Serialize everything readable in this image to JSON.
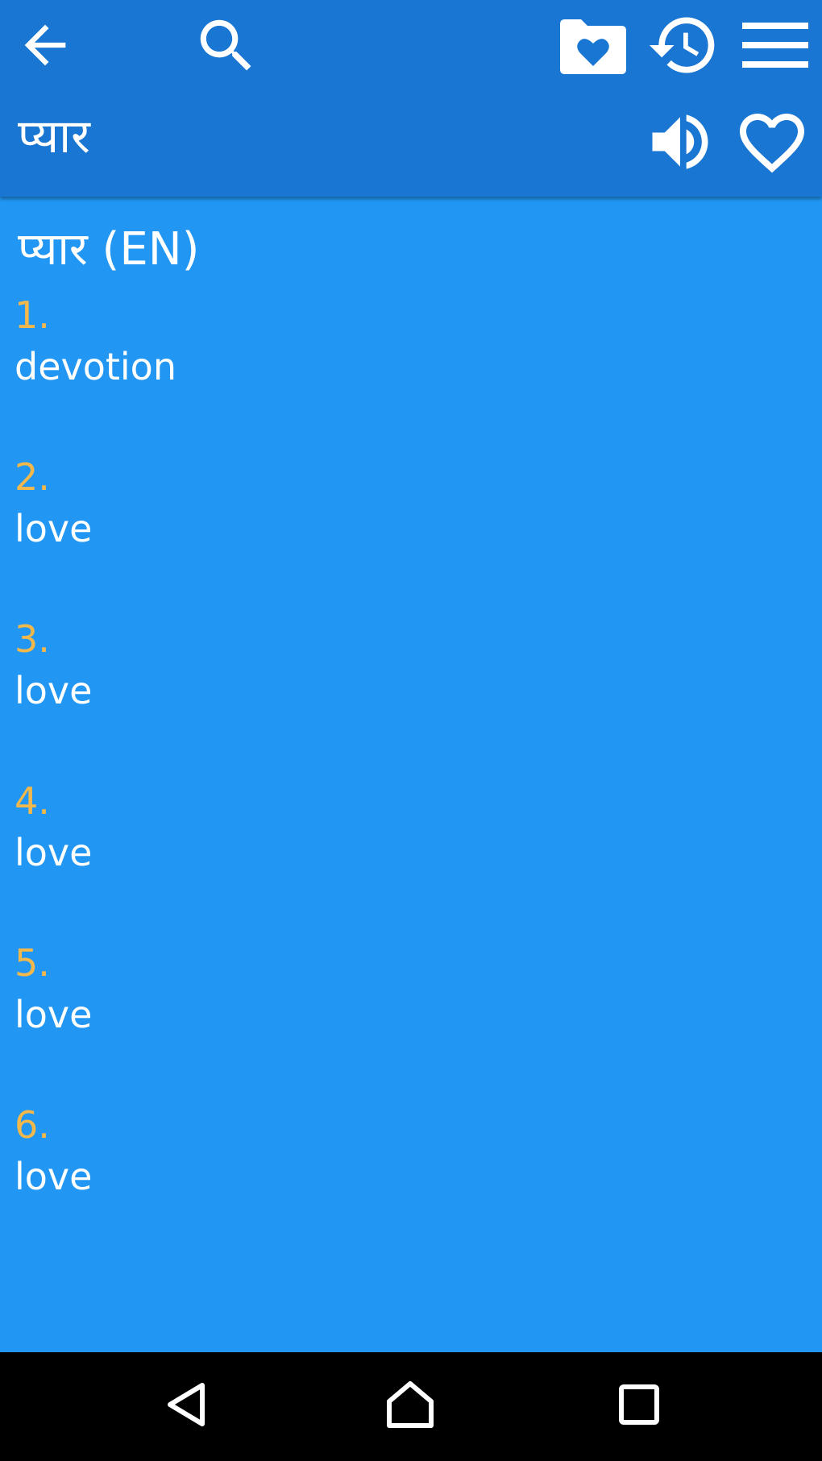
{
  "toolbar": {
    "icons": [
      "back-arrow-icon",
      "search-icon",
      "favorites-folder-icon",
      "history-icon",
      "menu-icon"
    ]
  },
  "word_bar": {
    "word": "प्यार",
    "icons": [
      "speaker-icon",
      "heart-outline-icon"
    ]
  },
  "entry": {
    "heading": "प्यार (EN)",
    "definitions": [
      {
        "number": "1.",
        "text": "devotion"
      },
      {
        "number": "2.",
        "text": "love"
      },
      {
        "number": "3.",
        "text": "love"
      },
      {
        "number": "4.",
        "text": "love"
      },
      {
        "number": "5.",
        "text": "love"
      },
      {
        "number": "6.",
        "text": "love"
      }
    ]
  },
  "navbar": {
    "icons": [
      "nav-back-icon",
      "nav-home-icon",
      "nav-recents-icon"
    ]
  },
  "colors": {
    "appbar": "#1976D2",
    "content_bg": "#2196F3",
    "number_accent": "#F2B84B",
    "text": "#FFFFFF",
    "navbar": "#000000"
  }
}
